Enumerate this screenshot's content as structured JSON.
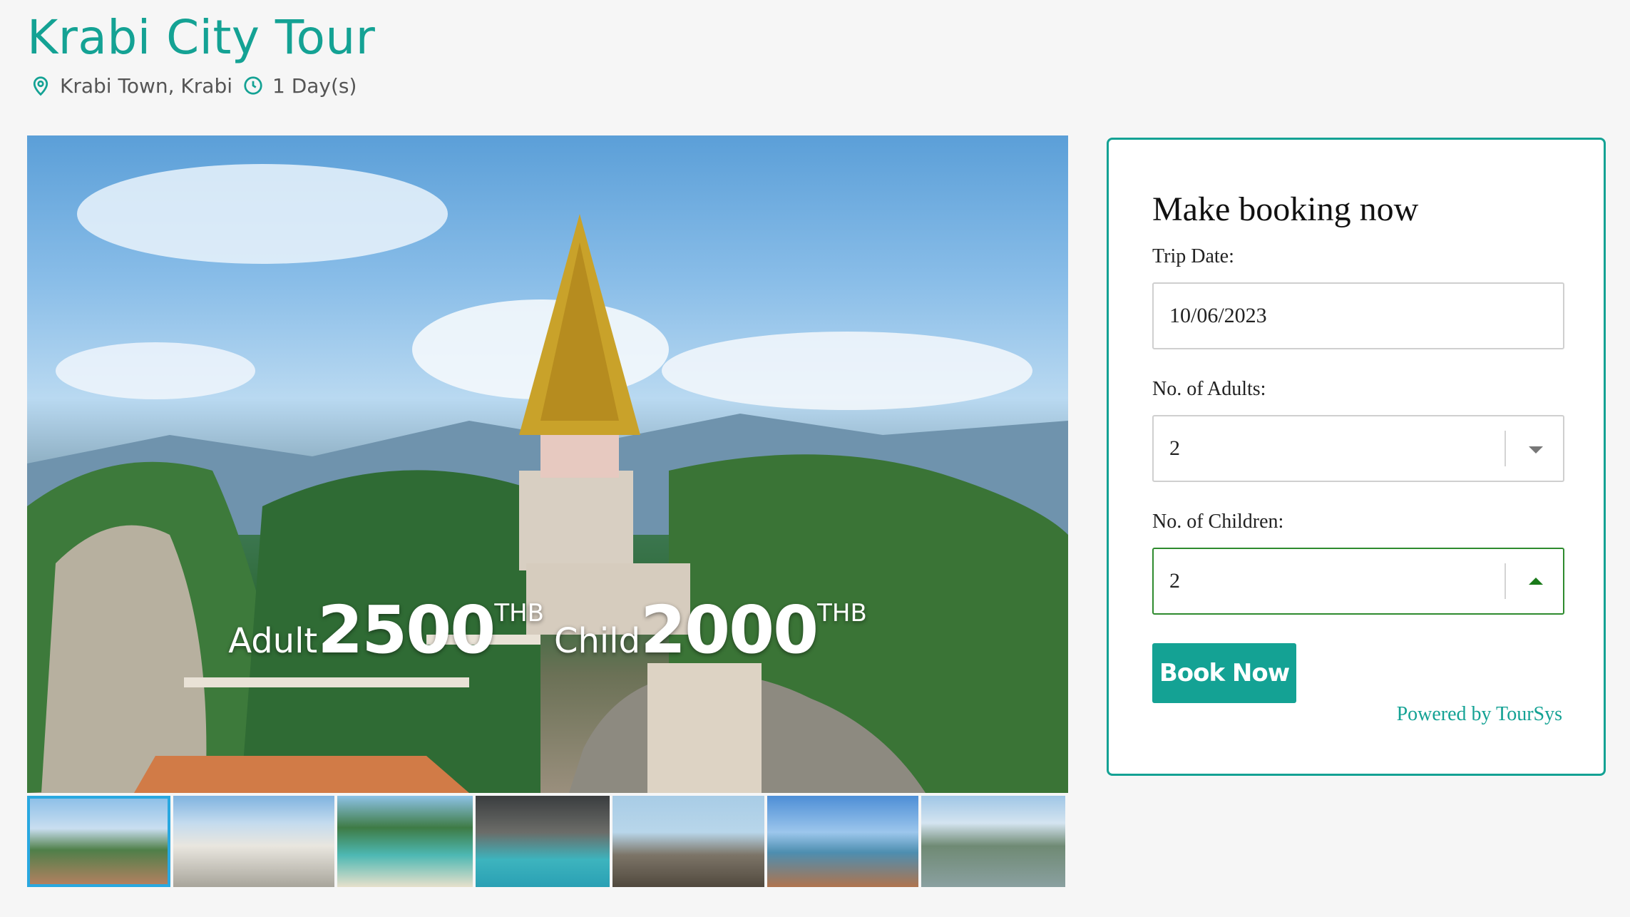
{
  "tour": {
    "title": "Krabi City Tour",
    "location": "Krabi Town, Krabi",
    "duration": "1 Day(s)"
  },
  "hero": {
    "adult_label": "Adult",
    "adult_price": "2500",
    "child_label": "Child",
    "child_price": "2000",
    "currency": "THB"
  },
  "thumbnails": [
    "temple-hilltop",
    "white-temple",
    "island-cliff",
    "cave-sea",
    "rock-beach",
    "sunset-beach",
    "river-town"
  ],
  "booking": {
    "heading": "Make booking now",
    "trip_date_label": "Trip Date:",
    "trip_date_value": "10/06/2023",
    "adults_label": "No. of Adults:",
    "adults_value": "2",
    "children_label": "No. of Children:",
    "children_value": "2",
    "book_button": "Book Now",
    "powered_by": "Powered by TourSys"
  },
  "colors": {
    "accent": "#14a294",
    "focus_border": "#2e8b2e",
    "thumb_active": "#29a8e0"
  }
}
